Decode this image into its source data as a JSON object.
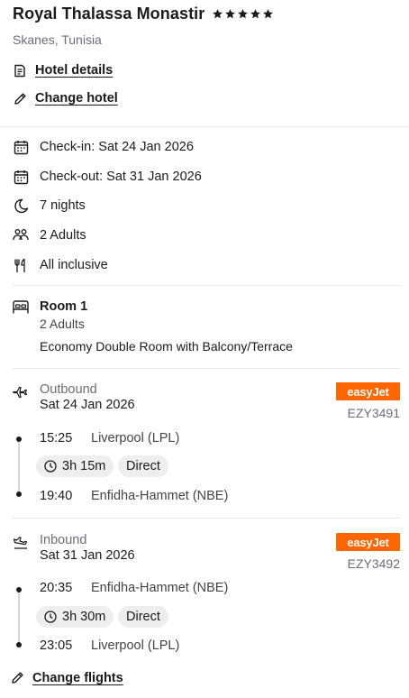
{
  "hotel": {
    "name": "Royal Thalassa Monastir",
    "star_rating": 5,
    "location": "Skanes, Tunisia"
  },
  "links": {
    "hotel_details": "Hotel details",
    "change_hotel": "Change hotel",
    "change_flights": "Change flights"
  },
  "stay": {
    "check_in": "Check-in: Sat 24 Jan 2026",
    "check_out": "Check-out: Sat 31 Jan 2026",
    "nights": "7 nights",
    "guests": "2 Adults",
    "board": "All inclusive"
  },
  "room": {
    "title": "Room 1",
    "adults": "2 Adults",
    "type": "Economy Double Room with Balcony/Terrace"
  },
  "flights": {
    "outbound": {
      "label": "Outbound",
      "date": "Sat 24 Jan 2026",
      "airline": "easyJet",
      "flight_number": "EZY3491",
      "depart_time": "15:25",
      "depart_airport": "Liverpool (LPL)",
      "duration": "3h 15m",
      "stops": "Direct",
      "arrive_time": "19:40",
      "arrive_airport": "Enfidha-Hammet (NBE)"
    },
    "inbound": {
      "label": "Inbound",
      "date": "Sat 31 Jan 2026",
      "airline": "easyJet",
      "flight_number": "EZY3492",
      "depart_time": "20:35",
      "depart_airport": "Enfidha-Hammet (NBE)",
      "duration": "3h 30m",
      "stops": "Direct",
      "arrive_time": "23:05",
      "arrive_airport": "Liverpool (LPL)"
    }
  },
  "colors": {
    "text": "#1b1b1b",
    "muted": "#6b6e78",
    "airline_orange": "#ff6600",
    "chip_bg": "#eeeeee",
    "divider": "#e6e6e6"
  },
  "icons": {
    "hotel_details": "document-icon",
    "change_hotel": "pencil-icon",
    "check_in": "calendar-icon",
    "check_out": "calendar-icon",
    "nights": "moon-icon",
    "guests": "people-icon",
    "board": "cutlery-icon",
    "room": "bed-icon",
    "outbound": "plane-takeoff-icon",
    "inbound": "plane-landing-icon",
    "duration": "clock-icon",
    "change_flights": "pencil-icon"
  }
}
